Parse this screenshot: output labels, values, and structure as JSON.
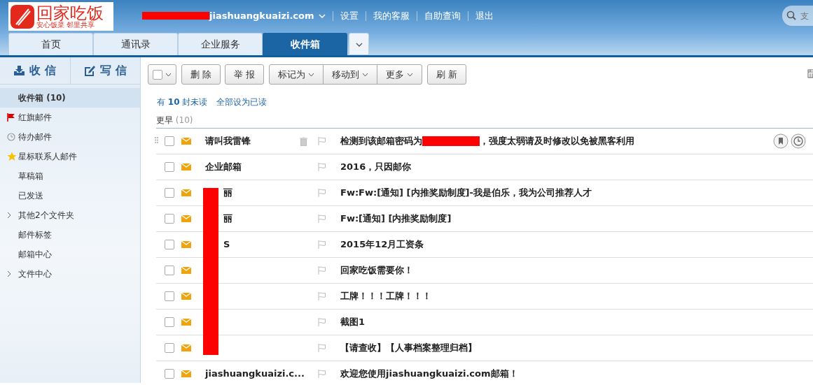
{
  "logo": {
    "title": "回家吃饭",
    "slogan": "安心饭菜 邻里共享"
  },
  "account": {
    "email": "jiashuangkuaizi.com",
    "redacted": true
  },
  "top_links": [
    "设置",
    "我的客服",
    "自助查询",
    "退出"
  ],
  "search": {
    "placeholder": "支"
  },
  "tabs": [
    {
      "label": "首页",
      "selected": false
    },
    {
      "label": "通讯录",
      "selected": false
    },
    {
      "label": "企业服务",
      "selected": false
    },
    {
      "label": "收件箱",
      "selected": true
    }
  ],
  "sidebar": {
    "receive": "收 信",
    "compose": "写 信",
    "items": [
      {
        "label": "收件箱 (10)",
        "kind": "plain",
        "selected": true
      },
      {
        "label": "红旗邮件",
        "kind": "flag",
        "selected": false
      },
      {
        "label": "待办邮件",
        "kind": "clock",
        "selected": false
      },
      {
        "label": "星标联系人邮件",
        "kind": "star",
        "selected": false
      },
      {
        "label": "草稿箱",
        "kind": "plain",
        "selected": false
      },
      {
        "label": "已发送",
        "kind": "plain",
        "selected": false
      },
      {
        "label": "其他2个文件夹",
        "kind": "folder",
        "selected": false
      },
      {
        "label": "邮件标签",
        "kind": "plain",
        "selected": false
      },
      {
        "label": "邮箱中心",
        "kind": "plain",
        "selected": false
      },
      {
        "label": "文件中心",
        "kind": "folder",
        "selected": false
      }
    ]
  },
  "toolbar": [
    {
      "label": "删 除",
      "kind": "button"
    },
    {
      "label": "举 报",
      "kind": "button"
    },
    {
      "label": "标记为",
      "kind": "menu"
    },
    {
      "label": "移动到",
      "kind": "menu"
    },
    {
      "label": "更多",
      "kind": "menu"
    },
    {
      "label": "刷 新",
      "kind": "button"
    }
  ],
  "unread": {
    "prefix": "有",
    "count": "10",
    "suffix": "封未读",
    "action": "全部设为已读"
  },
  "group": {
    "label": "更早",
    "count": "(10)"
  },
  "messages": [
    {
      "sender": "请叫我雷锋",
      "subject": "检测到该邮箱密码为",
      "subject_redacted": true,
      "subject_after": "，强度太弱请及时修改以免被黑客利用",
      "hover": true,
      "checked": false
    },
    {
      "sender": "企业邮箱",
      "subject": "2016，只因邮你",
      "subject_redacted": false,
      "hover": false,
      "checked": false
    },
    {
      "sender": "丽",
      "sender_redacted": true,
      "subject": "Fw:Fw:[通知] [内推奖励制度]-我是伯乐，我为公司推荐人才",
      "subject_redacted": false,
      "hover": false,
      "checked": false
    },
    {
      "sender": "丽",
      "sender_redacted": true,
      "subject": "Fw:[通知] [内推奖励制度]",
      "subject_redacted": false,
      "hover": false,
      "checked": false
    },
    {
      "sender": "S",
      "sender_redacted": true,
      "subject": "2015年12月工资条",
      "subject_redacted": false,
      "hover": false,
      "checked": false
    },
    {
      "sender_redacted": true,
      "subject": "回家吃饭需要你！",
      "subject_redacted": false,
      "hover": false,
      "checked": false
    },
    {
      "sender_redacted": true,
      "subject": "工牌！！！工牌！！！",
      "subject_redacted": false,
      "hover": false,
      "checked": false
    },
    {
      "sender_redacted": true,
      "subject": "截图1",
      "subject_redacted": false,
      "hover": false,
      "checked": false
    },
    {
      "sender_redacted": true,
      "subject": "【请查收】【人事档案整理归档】",
      "subject_redacted": false,
      "hover": false,
      "checked": false
    },
    {
      "sender": "jiashuangkuaizi.c...",
      "subject": "欢迎您使用jiashuangkuaizi.com邮箱！",
      "subject_redacted": false,
      "hover": false,
      "checked": false
    }
  ]
}
